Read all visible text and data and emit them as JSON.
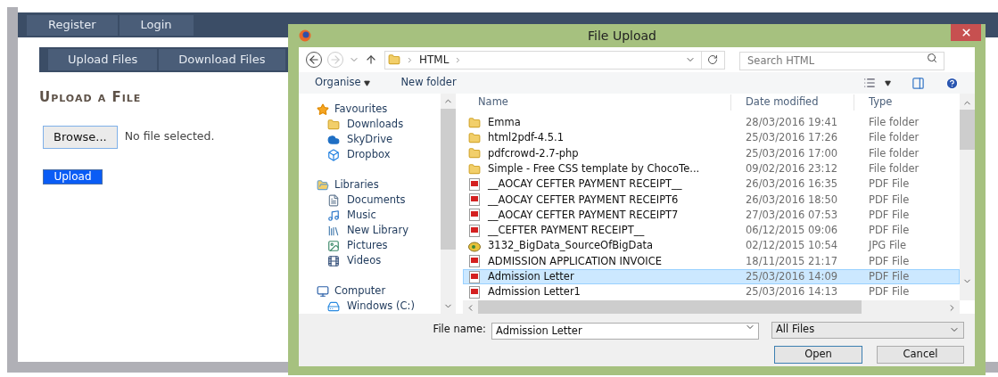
{
  "site_nav": [
    {
      "label": "Register"
    },
    {
      "label": "Login"
    }
  ],
  "tabs": [
    {
      "label": "Upload Files"
    },
    {
      "label": "Download Files"
    }
  ],
  "heading": "Upload a File",
  "file_input": {
    "button": "Browse...",
    "status": "No file selected."
  },
  "upload_button": "Upload",
  "dialog": {
    "title": "File Upload",
    "address": {
      "path": [
        "HTML"
      ]
    },
    "search": {
      "placeholder": "Search HTML"
    },
    "toolbar": {
      "organise": "Organise",
      "new_folder": "New folder"
    },
    "nav": [
      {
        "label": "Favourites",
        "kind": "star",
        "children": [
          {
            "label": "Downloads",
            "kind": "folder"
          },
          {
            "label": "SkyDrive",
            "kind": "cloud"
          },
          {
            "label": "Dropbox",
            "kind": "dropbox"
          }
        ]
      },
      {
        "label": "Libraries",
        "kind": "library",
        "children": [
          {
            "label": "Documents",
            "kind": "document"
          },
          {
            "label": "Music",
            "kind": "music"
          },
          {
            "label": "New Library",
            "kind": "library-file"
          },
          {
            "label": "Pictures",
            "kind": "pictures"
          },
          {
            "label": "Videos",
            "kind": "videos"
          }
        ]
      },
      {
        "label": "Computer",
        "kind": "computer",
        "children": [
          {
            "label": "Windows (C:)",
            "kind": "drive"
          }
        ]
      }
    ],
    "columns": [
      "Name",
      "Date modified",
      "Type"
    ],
    "rows": [
      {
        "name": "Emma",
        "date": "28/03/2016 19:41",
        "type": "File folder",
        "kind": "folder",
        "selected": false
      },
      {
        "name": "html2pdf-4.5.1",
        "date": "25/03/2016 17:26",
        "type": "File folder",
        "kind": "folder",
        "selected": false
      },
      {
        "name": "pdfcrowd-2.7-php",
        "date": "25/03/2016 17:00",
        "type": "File folder",
        "kind": "folder",
        "selected": false
      },
      {
        "name": "Simple - Free CSS template by ChocoTe...",
        "date": "09/02/2016 23:12",
        "type": "File folder",
        "kind": "folder",
        "selected": false
      },
      {
        "name": "__AOCAY CEFTER PAYMENT RECEIPT__",
        "date": "26/03/2016 16:35",
        "type": "PDF File",
        "kind": "pdf",
        "selected": false
      },
      {
        "name": "__AOCAY CEFTER PAYMENT RECEIPT6",
        "date": "26/03/2016 18:50",
        "type": "PDF File",
        "kind": "pdf",
        "selected": false
      },
      {
        "name": "__AOCAY CEFTER PAYMENT RECEIPT7",
        "date": "27/03/2016 07:53",
        "type": "PDF File",
        "kind": "pdf",
        "selected": false
      },
      {
        "name": "__CEFTER PAYMENT RECEIPT__",
        "date": "06/12/2015 09:06",
        "type": "PDF File",
        "kind": "pdf",
        "selected": false
      },
      {
        "name": "3132_BigData_SourceOfBigData",
        "date": "02/12/2015 10:54",
        "type": "JPG File",
        "kind": "jpg",
        "selected": false
      },
      {
        "name": "ADMISSION APPLICATION INVOICE",
        "date": "18/11/2015 21:17",
        "type": "PDF File",
        "kind": "pdf",
        "selected": false
      },
      {
        "name": "Admission Letter",
        "date": "25/03/2016 14:09",
        "type": "PDF File",
        "kind": "pdf",
        "selected": true
      },
      {
        "name": "Admission Letter1",
        "date": "25/03/2016 14:13",
        "type": "PDF File",
        "kind": "pdf",
        "selected": false
      }
    ],
    "file_name": {
      "label": "File name:",
      "value": "Admission Letter"
    },
    "filter": "All Files",
    "buttons": {
      "open": "Open",
      "cancel": "Cancel"
    }
  }
}
